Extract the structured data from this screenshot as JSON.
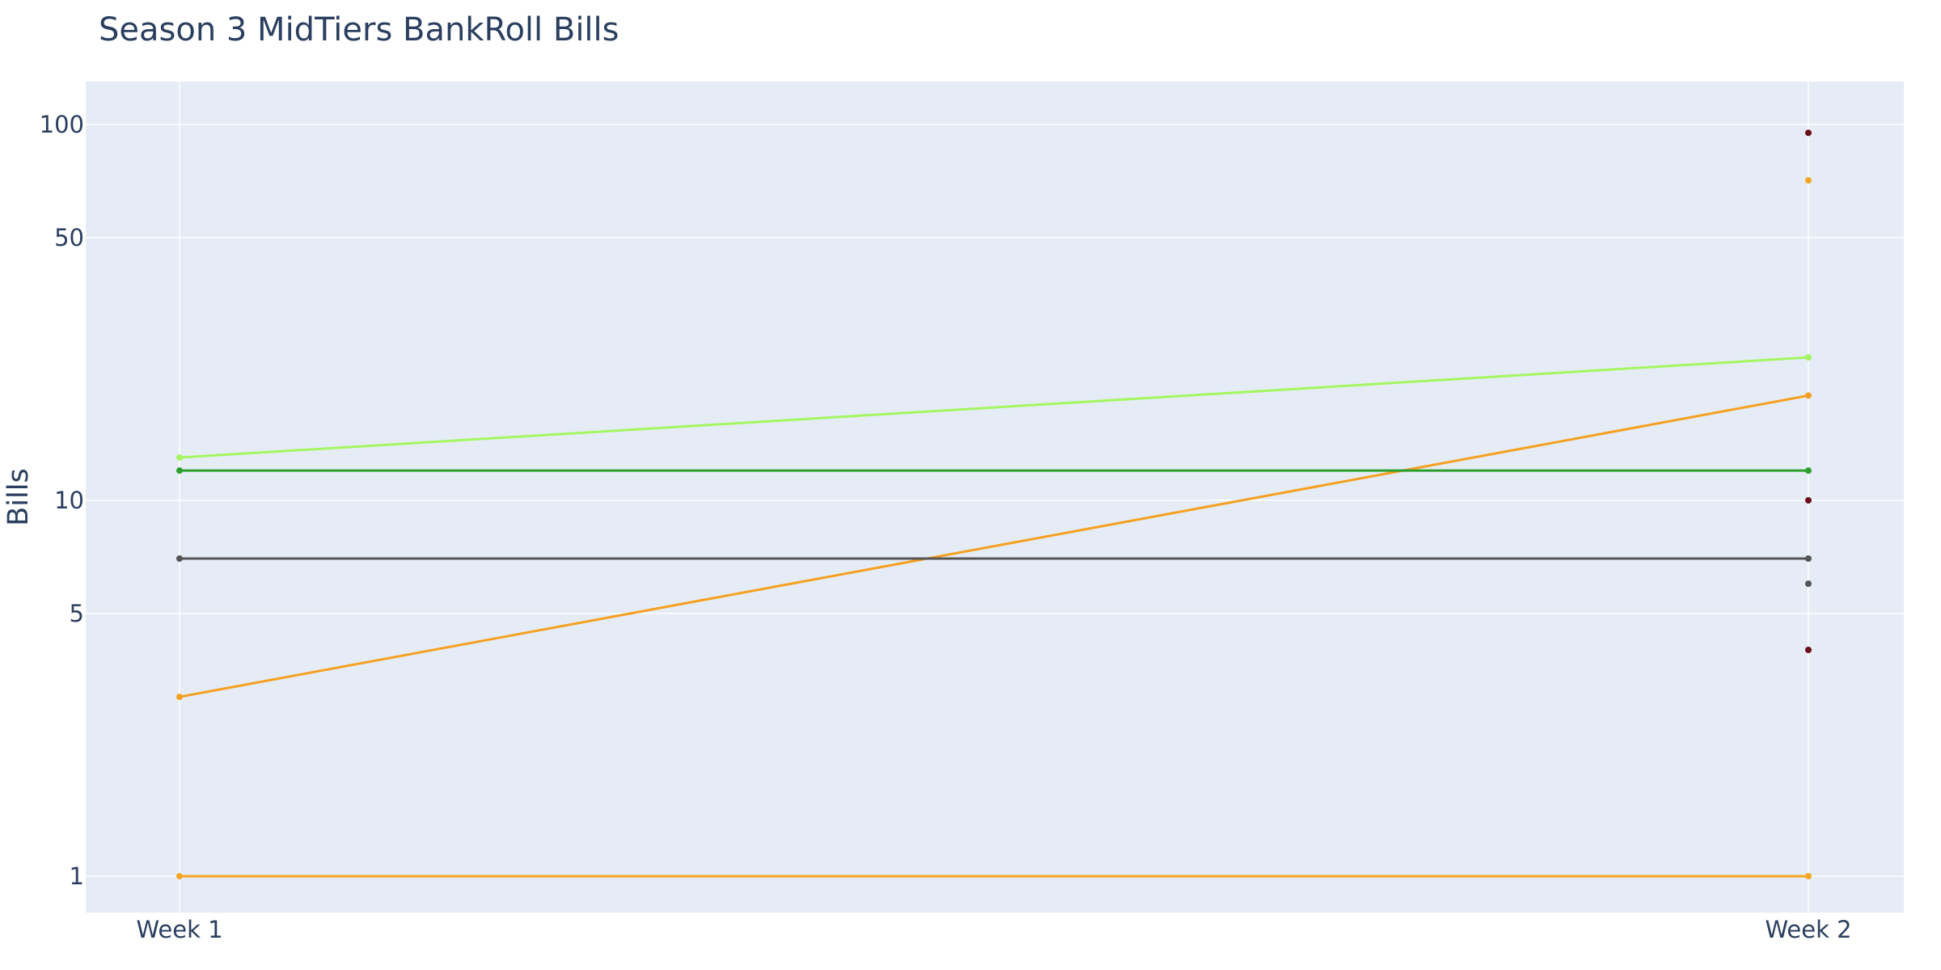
{
  "chart_data": {
    "type": "line",
    "title": "Season 3 MidTiers BankRoll Bills",
    "xlabel": "",
    "ylabel": "Bills",
    "yscale": "log",
    "ylim": [
      0.8,
      130
    ],
    "categories": [
      "Week 1",
      "Week 2"
    ],
    "y_ticks": [
      1,
      5,
      10,
      50,
      100
    ],
    "grid": true,
    "plot_background": "#e5ecf6",
    "series": [
      {
        "color": "#a3f760",
        "values": [
          13,
          24
        ]
      },
      {
        "color": "#f6a020",
        "values": [
          3,
          19
        ]
      },
      {
        "color": "#2ca02c",
        "values": [
          12,
          12
        ]
      },
      {
        "color": "#555555",
        "values": [
          7,
          7
        ]
      },
      {
        "color": "#f5a623",
        "values": [
          1,
          1
        ]
      },
      {
        "color": "#6b0f1a",
        "values": [
          null,
          95
        ]
      },
      {
        "color": "#f5a623",
        "values": [
          null,
          71
        ]
      },
      {
        "color": "#6b0f1a",
        "values": [
          null,
          10
        ]
      },
      {
        "color": "#555555",
        "values": [
          null,
          6
        ]
      },
      {
        "color": "#6b0f1a",
        "values": [
          null,
          4
        ]
      }
    ]
  }
}
